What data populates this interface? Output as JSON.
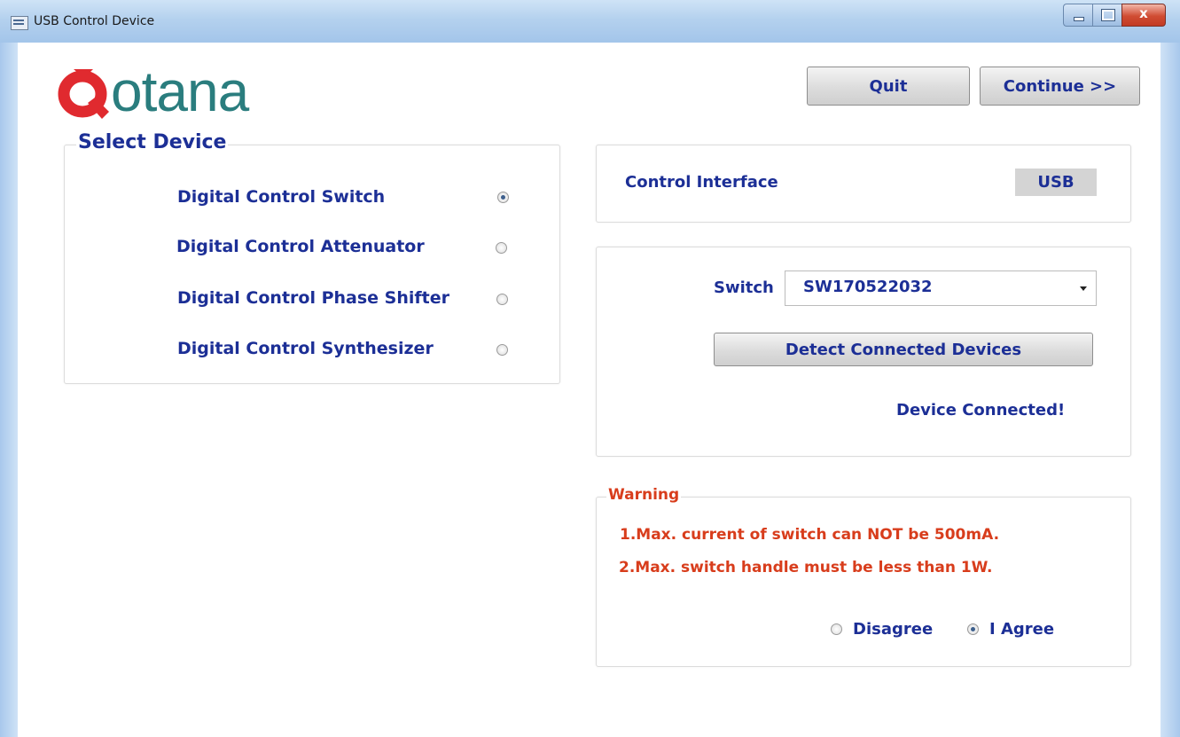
{
  "window": {
    "title": "USB Control Device",
    "close_glyph": "x"
  },
  "logo": {
    "first_letter": "Q",
    "rest": "otana",
    "first_color": "#e02a2f",
    "rest_color": "#2a7d7e"
  },
  "actions": {
    "quit_label": "Quit",
    "continue_label": "Continue >>"
  },
  "select_device": {
    "legend": "Select Device",
    "options": [
      {
        "label": "Digital Control Switch",
        "selected": true
      },
      {
        "label": "Digital Control Attenuator",
        "selected": false
      },
      {
        "label": "Digital Control Phase Shifter",
        "selected": false
      },
      {
        "label": "Digital Control Synthesizer",
        "selected": false
      }
    ]
  },
  "interface": {
    "label": "Control Interface",
    "value": "USB"
  },
  "switch_panel": {
    "switch_label": "Switch",
    "switch_value": "SW170522032",
    "detect_label": "Detect Connected Devices",
    "status": "Device Connected!"
  },
  "warning": {
    "legend": "Warning",
    "lines": [
      "1.Max. current of switch can NOT be 500mA.",
      "2.Max. switch handle must be less than 1W."
    ],
    "disagree_label": "Disagree",
    "agree_label": "I Agree",
    "agreed": true
  },
  "colors": {
    "text_blue": "#1c2f96",
    "warning_red": "#d83d1c",
    "titlebar": "#b4d1ee"
  }
}
